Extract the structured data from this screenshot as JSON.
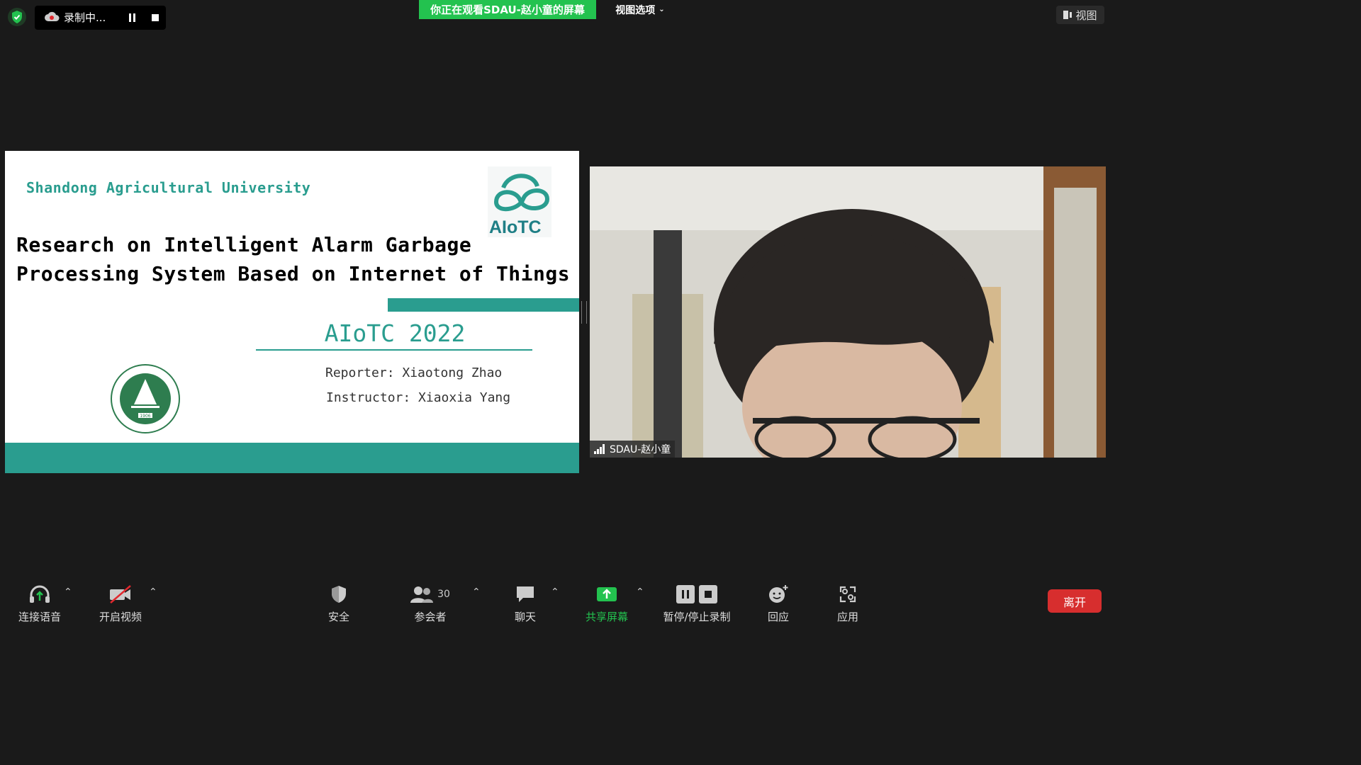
{
  "top": {
    "recording_label": "录制中...",
    "share_banner": "你正在观看SDAU-赵小童的屏幕",
    "view_options": "视图选项",
    "view_button": "视图"
  },
  "slide": {
    "university": "Shandong Agricultural University",
    "title_line1": "Research on Intelligent Alarm Garbage",
    "title_line2": "Processing System Based on Internet of Things",
    "logo_text": "AIoTC",
    "conference": "AIoTC 2022",
    "reporter": "Reporter: Xiaotong Zhao",
    "instructor": "Instructor: Xiaoxia Yang",
    "seal_year": "1906"
  },
  "video": {
    "participant_name": "SDAU-赵小童"
  },
  "toolbar": {
    "audio": "连接语音",
    "video": "开启视频",
    "security": "安全",
    "participants": "参会者",
    "participants_count": "30",
    "chat": "聊天",
    "share": "共享屏幕",
    "record": "暂停/停止录制",
    "reactions": "回应",
    "apps": "应用",
    "leave": "离开"
  },
  "colors": {
    "accent": "#2a9d8f",
    "share_green": "#23c24f",
    "leave_red": "#d72e2e"
  }
}
